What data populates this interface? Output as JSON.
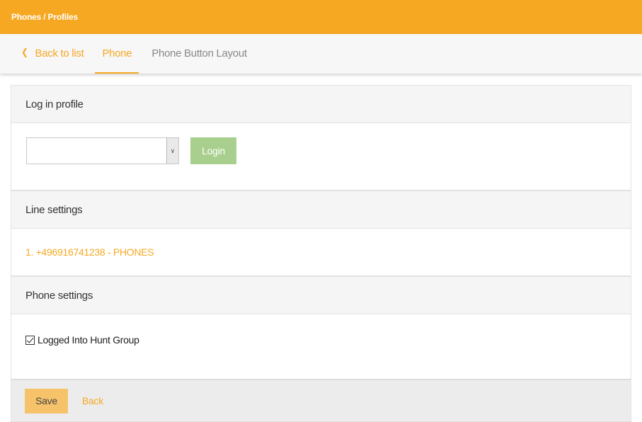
{
  "header": {
    "breadcrumb": "Phones / Profiles"
  },
  "tabs": {
    "back_icon": "chevron-left-icon",
    "back_label": "Back to list",
    "items": [
      {
        "label": "Phone",
        "active": true
      },
      {
        "label": "Phone Button Layout",
        "active": false
      }
    ]
  },
  "login_profile": {
    "title": "Log in profile",
    "select_value": "",
    "login_button": "Login"
  },
  "line_settings": {
    "title": "Line settings",
    "lines": [
      "1. +496916741238 - PHONES"
    ]
  },
  "phone_settings": {
    "title": "Phone settings",
    "hunt_group_label": "Logged Into Hunt Group",
    "hunt_group_checked": true
  },
  "footer": {
    "save_label": "Save",
    "back_label": "Back"
  },
  "colors": {
    "accent": "#f6a823",
    "login_button": "#a8cf8d",
    "save_button": "#f6c36a"
  }
}
